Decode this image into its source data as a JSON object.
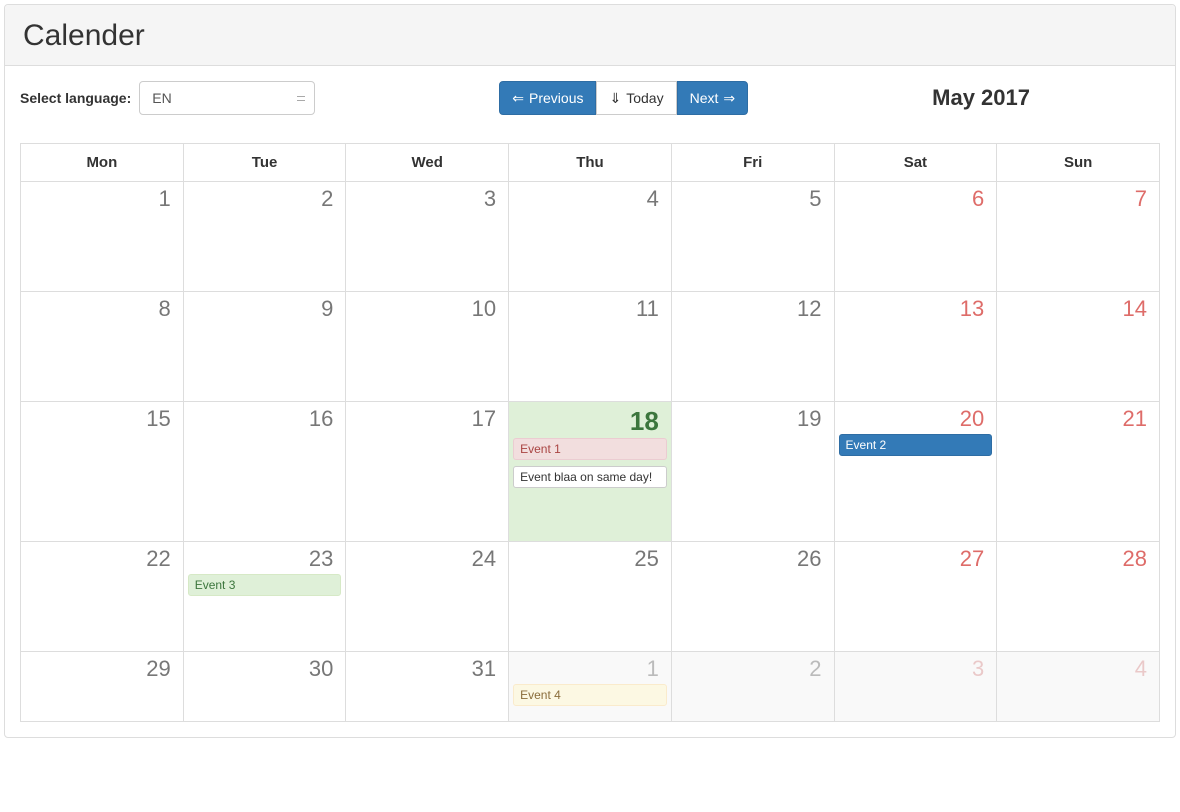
{
  "header": {
    "title": "Calender"
  },
  "toolbar": {
    "language_label": "Select language:",
    "language_value": "EN",
    "prev_label": "Previous",
    "today_label": "Today",
    "next_label": "Next",
    "month_title": "May 2017"
  },
  "weekdays": [
    "Mon",
    "Tue",
    "Wed",
    "Thu",
    "Fri",
    "Sat",
    "Sun"
  ],
  "weeks": [
    [
      {
        "num": "1"
      },
      {
        "num": "2"
      },
      {
        "num": "3"
      },
      {
        "num": "4"
      },
      {
        "num": "5"
      },
      {
        "num": "6",
        "weekend": true
      },
      {
        "num": "7",
        "weekend": true
      }
    ],
    [
      {
        "num": "8"
      },
      {
        "num": "9"
      },
      {
        "num": "10"
      },
      {
        "num": "11"
      },
      {
        "num": "12"
      },
      {
        "num": "13",
        "weekend": true
      },
      {
        "num": "14",
        "weekend": true
      }
    ],
    [
      {
        "num": "15"
      },
      {
        "num": "16"
      },
      {
        "num": "17"
      },
      {
        "num": "18",
        "today": true,
        "events": [
          {
            "title": "Event 1",
            "style": "badge-danger"
          },
          {
            "title": "Event blaa on same day!",
            "style": "badge-default"
          }
        ]
      },
      {
        "num": "19"
      },
      {
        "num": "20",
        "weekend": true,
        "events": [
          {
            "title": "Event 2",
            "style": "badge-primary"
          }
        ]
      },
      {
        "num": "21",
        "weekend": true
      }
    ],
    [
      {
        "num": "22"
      },
      {
        "num": "23",
        "events": [
          {
            "title": "Event 3",
            "style": "badge-success"
          }
        ]
      },
      {
        "num": "24"
      },
      {
        "num": "25"
      },
      {
        "num": "26"
      },
      {
        "num": "27",
        "weekend": true
      },
      {
        "num": "28",
        "weekend": true
      }
    ],
    [
      {
        "num": "29"
      },
      {
        "num": "30"
      },
      {
        "num": "31"
      },
      {
        "num": "1",
        "other": true,
        "events": [
          {
            "title": "Event 4",
            "style": "badge-warning"
          }
        ]
      },
      {
        "num": "2",
        "other": true
      },
      {
        "num": "3",
        "other": true,
        "weekend": true
      },
      {
        "num": "4",
        "other": true,
        "weekend": true
      }
    ]
  ]
}
